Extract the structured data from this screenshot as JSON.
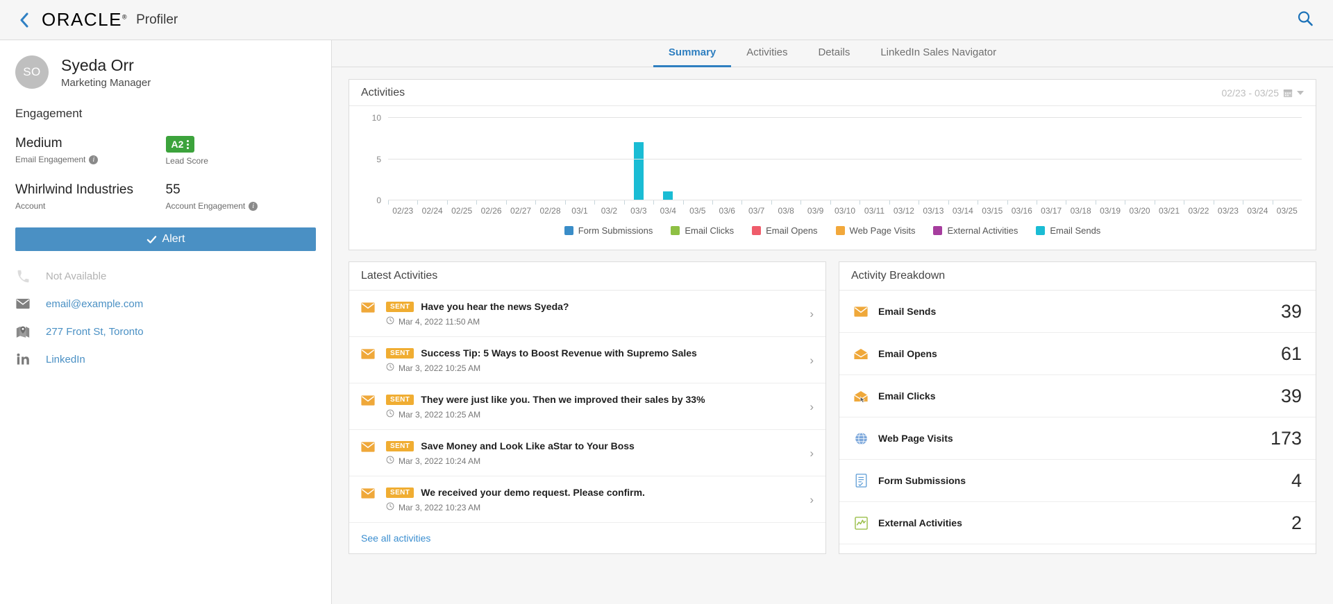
{
  "header": {
    "back_icon": "chevron-left-icon",
    "logo": "ORACLE",
    "app_name": "Profiler",
    "search_icon": "search-icon"
  },
  "sidebar": {
    "avatar_initials": "SO",
    "name": "Syeda Orr",
    "title": "Marketing Manager",
    "engagement_heading": "Engagement",
    "email_engagement_value": "Medium",
    "email_engagement_label": "Email Engagement",
    "lead_score_value": "A2",
    "lead_score_label": "Lead Score",
    "account_value": "Whirlwind Industries",
    "account_label": "Account",
    "account_engagement_value": "55",
    "account_engagement_label": "Account Engagement",
    "alert_button": "Alert",
    "contacts": [
      {
        "icon": "phone-icon",
        "text": "Not Available",
        "muted": true
      },
      {
        "icon": "envelope-icon",
        "text": "email@example.com",
        "muted": false
      },
      {
        "icon": "map-pin-icon",
        "text": "277 Front St, Toronto",
        "muted": false
      },
      {
        "icon": "linkedin-icon",
        "text": "LinkedIn",
        "muted": false
      }
    ]
  },
  "tabs": [
    {
      "label": "Summary",
      "active": true
    },
    {
      "label": "Activities",
      "active": false
    },
    {
      "label": "Details",
      "active": false
    },
    {
      "label": "LinkedIn Sales Navigator",
      "active": false
    }
  ],
  "activities_card": {
    "title": "Activities",
    "date_range": "02/23 - 03/25",
    "calendar_icon": "calendar-icon"
  },
  "chart_data": {
    "type": "bar",
    "title": "Activities",
    "xlabel": "",
    "ylabel": "",
    "ylim": [
      0,
      10
    ],
    "yticks": [
      0,
      5,
      10
    ],
    "grid": true,
    "legend_position": "bottom",
    "categories": [
      "02/23",
      "02/24",
      "02/25",
      "02/26",
      "02/27",
      "02/28",
      "03/1",
      "03/2",
      "03/3",
      "03/4",
      "03/5",
      "03/6",
      "03/7",
      "03/8",
      "03/9",
      "03/10",
      "03/11",
      "03/12",
      "03/13",
      "03/14",
      "03/15",
      "03/16",
      "03/17",
      "03/18",
      "03/19",
      "03/20",
      "03/21",
      "03/22",
      "03/23",
      "03/24",
      "03/25"
    ],
    "series": [
      {
        "name": "Form Submissions",
        "color": "#3a8dc8",
        "values": [
          0,
          0,
          0,
          0,
          0,
          0,
          0,
          0,
          0,
          0,
          0,
          0,
          0,
          0,
          0,
          0,
          0,
          0,
          0,
          0,
          0,
          0,
          0,
          0,
          0,
          0,
          0,
          0,
          0,
          0,
          0
        ]
      },
      {
        "name": "Email Clicks",
        "color": "#8ec044",
        "values": [
          0,
          0,
          0,
          0,
          0,
          0,
          0,
          0,
          0,
          0,
          0,
          0,
          0,
          0,
          0,
          0,
          0,
          0,
          0,
          0,
          0,
          0,
          0,
          0,
          0,
          0,
          0,
          0,
          0,
          0,
          0
        ]
      },
      {
        "name": "Email Opens",
        "color": "#ef5c6b",
        "values": [
          0,
          0,
          0,
          0,
          0,
          0,
          0,
          0,
          0,
          0,
          0,
          0,
          0,
          0,
          0,
          0,
          0,
          0,
          0,
          0,
          0,
          0,
          0,
          0,
          0,
          0,
          0,
          0,
          0,
          0,
          0
        ]
      },
      {
        "name": "Web Page Visits",
        "color": "#f2a83b",
        "values": [
          0,
          0,
          0,
          0,
          0,
          0,
          0,
          0,
          0,
          0,
          0,
          0,
          0,
          0,
          0,
          0,
          0,
          0,
          0,
          0,
          0,
          0,
          0,
          0,
          0,
          0,
          0,
          0,
          0,
          0,
          0
        ]
      },
      {
        "name": "External Activities",
        "color": "#a63d9e",
        "values": [
          0,
          0,
          0,
          0,
          0,
          0,
          0,
          0,
          0,
          0,
          0,
          0,
          0,
          0,
          0,
          0,
          0,
          0,
          0,
          0,
          0,
          0,
          0,
          0,
          0,
          0,
          0,
          0,
          0,
          0,
          0
        ]
      },
      {
        "name": "Email Sends",
        "color": "#1abcd4",
        "values": [
          0,
          0,
          0,
          0,
          0,
          0,
          0,
          0,
          7,
          1,
          0,
          0,
          0,
          0,
          0,
          0,
          0,
          0,
          0,
          0,
          0,
          0,
          0,
          0,
          0,
          0,
          0,
          0,
          0,
          0,
          0
        ]
      }
    ]
  },
  "latest_activities": {
    "title": "Latest Activities",
    "see_all": "See all activities",
    "items": [
      {
        "icon": "envelope-icon",
        "badge": "SENT",
        "title": "Have you hear the news Syeda?",
        "time": "Mar 4, 2022 11:50 AM"
      },
      {
        "icon": "envelope-icon",
        "badge": "SENT",
        "title": "Success Tip: 5 Ways to Boost Revenue with Supremo Sales",
        "time": "Mar 3, 2022 10:25 AM"
      },
      {
        "icon": "envelope-icon",
        "badge": "SENT",
        "title": "They were just like you. Then we improved their sales by 33%",
        "time": "Mar 3, 2022 10:25 AM"
      },
      {
        "icon": "envelope-icon",
        "badge": "SENT",
        "title": "Save Money and Look Like aStar to Your Boss",
        "time": "Mar 3, 2022 10:24 AM"
      },
      {
        "icon": "envelope-icon",
        "badge": "SENT",
        "title": "We received your demo request. Please confirm.",
        "time": "Mar 3, 2022 10:23 AM"
      }
    ]
  },
  "activity_breakdown": {
    "title": "Activity Breakdown",
    "items": [
      {
        "icon": "envelope-icon",
        "label": "Email Sends",
        "count": "39"
      },
      {
        "icon": "envelope-open-icon",
        "label": "Email Opens",
        "count": "61"
      },
      {
        "icon": "envelope-click-icon",
        "label": "Email Clicks",
        "count": "39"
      },
      {
        "icon": "globe-icon",
        "label": "Web Page Visits",
        "count": "173"
      },
      {
        "icon": "form-document-icon",
        "label": "Form Submissions",
        "count": "4"
      },
      {
        "icon": "chart-line-icon",
        "label": "External Activities",
        "count": "2"
      }
    ]
  }
}
